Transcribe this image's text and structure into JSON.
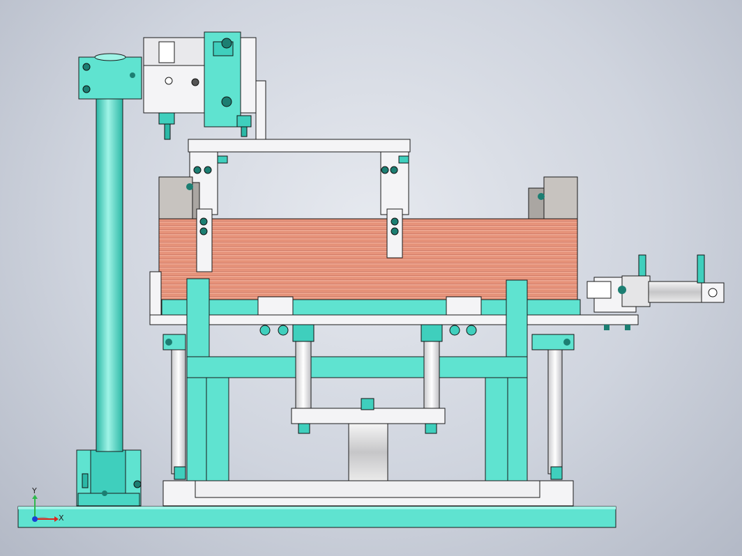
{
  "view": {
    "background_top": "#e6e9ef",
    "background_edge": "#b3b9c6"
  },
  "colors": {
    "cyan": "#5fe3d0",
    "cyan_dark": "#27b3a3",
    "white_part": "#f4f4f6",
    "grey_part": "#c7c3bf",
    "copper": "#e99a83",
    "copper_dark": "#c9715c",
    "outline": "#1a1a1a"
  },
  "triad": {
    "x_label": "X",
    "y_label": "Y",
    "x_color": "#e0241b",
    "y_color": "#2db84b",
    "origin_color": "#1a3fd6"
  }
}
